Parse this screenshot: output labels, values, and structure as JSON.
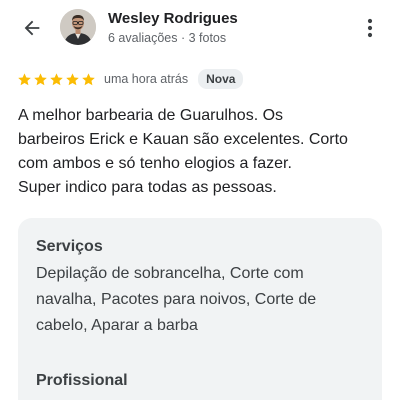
{
  "author": {
    "name": "Wesley Rodrigues",
    "meta": "6 avaliações · 3 fotos"
  },
  "review": {
    "rating": 5,
    "max_rating": 5,
    "time": "uma hora atrás",
    "badge": "Nova",
    "text_lines": [
      "A melhor barbearia de Guarulhos. Os",
      "barbeiros Erick e Kauan são excelentes. Corto",
      "com ambos e só tenho elogios a fazer.",
      "Super indico para todas as pessoas."
    ]
  },
  "details": {
    "services_title": "Serviços",
    "services_lines": [
      "Depilação de sobrancelha, Corte com",
      "navalha, Pacotes para noivos, Corte de",
      "cabelo, Aparar a barba"
    ],
    "professional_title": "Profissional"
  },
  "colors": {
    "star": "#fbbc04",
    "card_bg": "#f1f3f4",
    "badge_bg": "#eceff1"
  },
  "icons": {
    "back": "arrow-back-icon",
    "more": "more-vert-icon"
  }
}
